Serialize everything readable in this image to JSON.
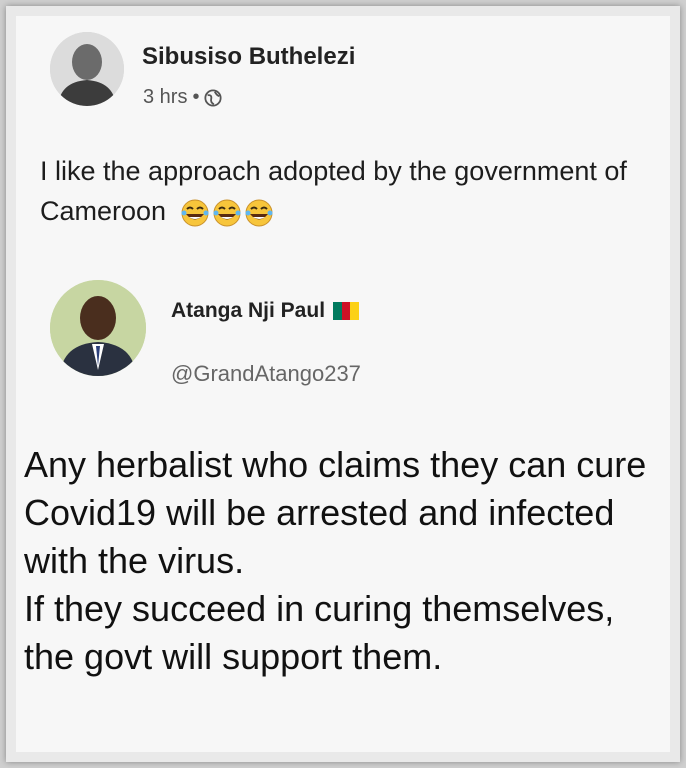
{
  "post": {
    "author_name": "Sibusiso Buthelezi",
    "time": "3 hrs",
    "separator": "•",
    "privacy_icon": "globe-icon",
    "text": "I like the approach adopted by the government of Cameroon",
    "emojis": [
      "tears-of-joy-emoji",
      "tears-of-joy-emoji",
      "tears-of-joy-emoji"
    ]
  },
  "tweet": {
    "author_name": "Atanga Nji Paul",
    "flag_icon": "cameroon-flag-icon",
    "handle": "@GrandAtango237",
    "paragraph_1": "Any herbalist who claims they can cure Covid19 will be arrested and infected with the virus.",
    "paragraph_2": "If they succeed in curing themselves, the govt will support them."
  },
  "colors": {
    "cameroon_green": "#007a5e",
    "cameroon_red": "#ce1126",
    "cameroon_yellow": "#fcd116",
    "emoji_yellow": "#f7c53b"
  }
}
